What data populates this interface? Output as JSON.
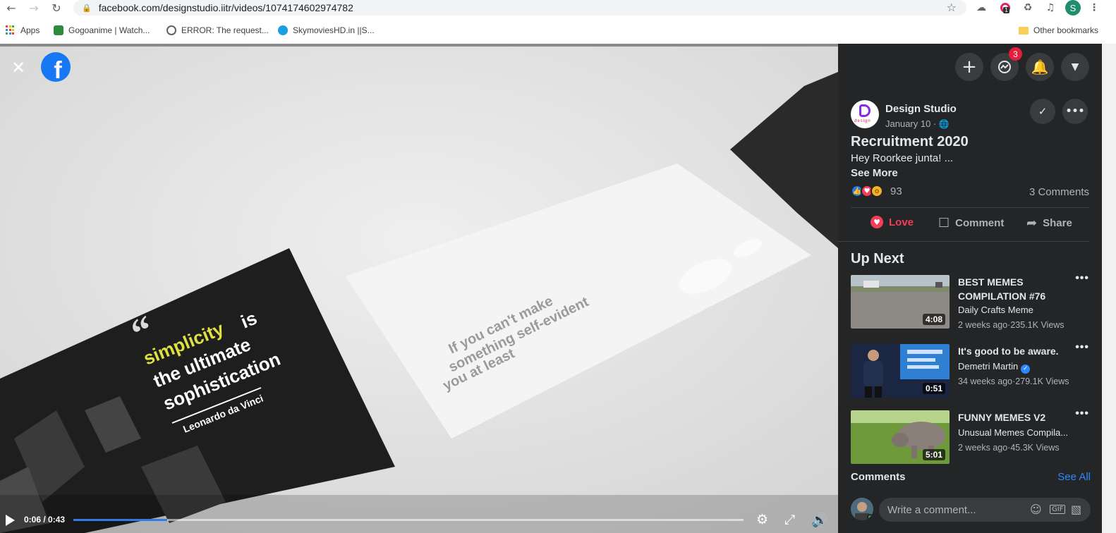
{
  "browser": {
    "url": "facebook.com/designstudio.iitr/videos/1074174602974782",
    "profile_initial": "S",
    "extension_badge": "1"
  },
  "bookmarks": [
    {
      "label": "Apps"
    },
    {
      "label": "Gogoanime | Watch..."
    },
    {
      "label": "ERROR: The request..."
    },
    {
      "label": "SkymoviesHD.in ||S..."
    }
  ],
  "other_bookmarks": "Other bookmarks",
  "video": {
    "current_time": "0:06 / 0:43",
    "progress_fraction": 0.14
  },
  "header": {
    "messenger_badge": "3"
  },
  "post": {
    "page_name": "Design Studio",
    "date": "January 10 · ",
    "title": "Recruitment 2020",
    "body": "Hey Roorkee junta! ...",
    "see_more": "See More",
    "reaction_count": "93",
    "comments_count": "3 Comments"
  },
  "actions": {
    "love": "Love",
    "comment": "Comment",
    "share": "Share"
  },
  "up_next": {
    "title": "Up Next",
    "videos": [
      {
        "title": "BEST MEMES COMPILATION #76",
        "channel": "Daily Crafts Meme",
        "meta": "2 weeks ago·235.1K Views",
        "duration": "4:08"
      },
      {
        "title": "It's good to be aware.",
        "channel": "Demetri Martin",
        "meta": "34 weeks ago·279.1K Views",
        "duration": "0:51"
      },
      {
        "title": "FUNNY MEMES V2",
        "channel": "Unusual Memes Compila...",
        "meta": "2 weeks ago·45.3K Views",
        "duration": "5:01"
      }
    ]
  },
  "comments": {
    "label": "Comments",
    "see_all": "See All",
    "placeholder": "Write a comment..."
  },
  "colors": {
    "panel_bg": "#242526",
    "accent_blue": "#2d88ff",
    "love_red": "#f33e58",
    "facebook_blue": "#1877f2"
  }
}
